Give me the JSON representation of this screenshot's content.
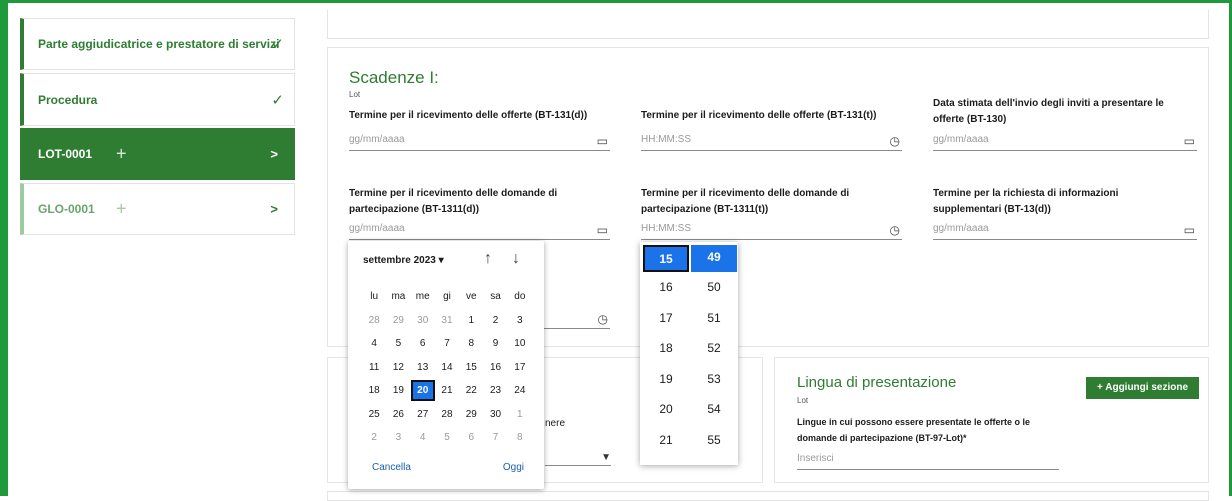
{
  "sidebar": {
    "items": [
      {
        "label": "Parte aggiudicatrice e prestatore di servizi"
      },
      {
        "label": "Procedura"
      },
      {
        "label": "LOT-0001"
      },
      {
        "label": "GLO-0001"
      }
    ]
  },
  "deadlines": {
    "title": "Scadenze I:",
    "subtitle": "Lot",
    "fields": [
      {
        "label": "Termine per il ricevimento delle offerte (BT-131(d))",
        "placeholder": "gg/mm/aaaa"
      },
      {
        "label": "Termine per il ricevimento delle offerte (BT-131(t))",
        "placeholder": "HH:MM:SS"
      },
      {
        "label": "Data stimata dell'invio degli inviti a presentare le offerte (BT-130)",
        "placeholder": "gg/mm/aaaa"
      },
      {
        "label": "Termine per il ricevimento delle domande di partecipazione (BT-1311(d))",
        "placeholder": "gg/mm/aaaa"
      },
      {
        "label": "Termine per il ricevimento delle domande di partecipazione (BT-1311(t))",
        "placeholder": "HH:MM:SS"
      },
      {
        "label": "Termine per la richiesta di informazioni supplementari (BT-13(d))",
        "placeholder": "gg/mm/aaaa"
      }
    ]
  },
  "datepicker": {
    "month": "settembre 2023",
    "weekdays": [
      "lu",
      "ma",
      "me",
      "gi",
      "ve",
      "sa",
      "do"
    ],
    "weeks": [
      [
        "28",
        "29",
        "30",
        "31",
        "1",
        "2",
        "3"
      ],
      [
        "4",
        "5",
        "6",
        "7",
        "8",
        "9",
        "10"
      ],
      [
        "11",
        "12",
        "13",
        "14",
        "15",
        "16",
        "17"
      ],
      [
        "18",
        "19",
        "20",
        "21",
        "22",
        "23",
        "24"
      ],
      [
        "25",
        "26",
        "27",
        "28",
        "29",
        "30",
        "1"
      ],
      [
        "2",
        "3",
        "4",
        "5",
        "6",
        "7",
        "8"
      ]
    ],
    "selected": "20",
    "cancel": "Cancella",
    "today": "Oggi"
  },
  "timepicker": {
    "hours": [
      "15",
      "16",
      "17",
      "18",
      "19",
      "20",
      "21"
    ],
    "minutes": [
      "49",
      "50",
      "51",
      "52",
      "53",
      "54",
      "55"
    ]
  },
  "partial_text": "nere",
  "language": {
    "title": "Lingua di presentazione",
    "subtitle": "Lot",
    "add_button": "Aggiungi sezione",
    "field_label": "Lingue in cui possono essere presentate le offerte o le domande di partecipazione (BT-97-Lot)*",
    "placeholder": "Inserisci"
  },
  "colors": {
    "brand": "#2e7d32",
    "accent": "#1a73e8",
    "frame": "#1f9a3a"
  }
}
